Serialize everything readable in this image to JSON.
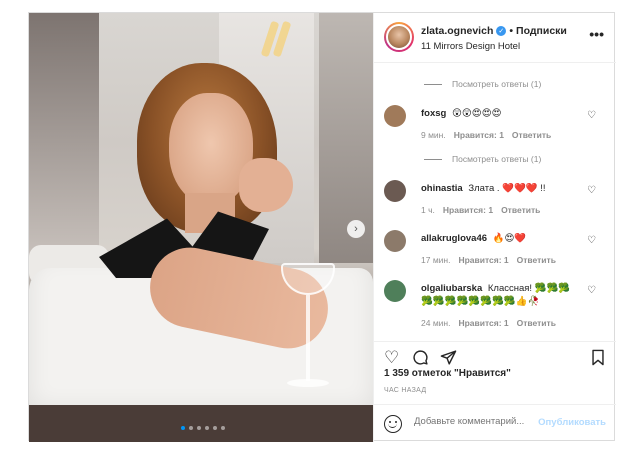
{
  "header": {
    "username": "zlata.ognevich",
    "separator": "•",
    "follow_label": "Подписки",
    "location": "11 Mirrors Design Hotel",
    "more_icon": "more-icon"
  },
  "view_replies": [
    {
      "label": "Посмотреть ответы (1)"
    },
    {
      "label": "Посмотреть ответы (1)"
    }
  ],
  "comments": [
    {
      "username": "foxsg",
      "text": "😲😲😍😍😍",
      "time": "9 мин.",
      "likes": "Нравится: 1",
      "reply": "Ответить",
      "avatar_color": "#a07a5a"
    },
    {
      "username": "ohinastia",
      "text": "Злата . ❤️❤️❤️ !!",
      "time": "1 ч.",
      "likes": "Нравится: 1",
      "reply": "Ответить",
      "avatar_color": "#6b5a52"
    },
    {
      "username": "allakruglova46",
      "text": "🔥😍❤️",
      "time": "17 мин.",
      "likes": "Нравится: 1",
      "reply": "Ответить",
      "avatar_color": "#8c7a6a"
    },
    {
      "username": "olgaliubarska",
      "text": "Классная! 🥦🥦🥦🥦🥦🥦🥦🥦🥦🥦🥦👍🥀",
      "time": "24 мин.",
      "likes": "Нравится: 1",
      "reply": "Ответить",
      "avatar_color": "#4f7f5a"
    }
  ],
  "actions": {
    "like_icon": "heart-icon",
    "comment_icon": "comment-icon",
    "share_icon": "share-icon",
    "save_icon": "bookmark-icon"
  },
  "likes_text": "1 359 отметок \"Нравится\"",
  "time_ago": "час назад",
  "add_comment": {
    "placeholder": "Добавьте комментарий...",
    "post_label": "Опубликовать"
  },
  "carousel": {
    "total": 6,
    "active": 1
  },
  "colors": {
    "accent": "#0095f6",
    "verified": "#3897f0",
    "muted": "#8e8e8e",
    "post_disabled": "#b3dbff"
  }
}
